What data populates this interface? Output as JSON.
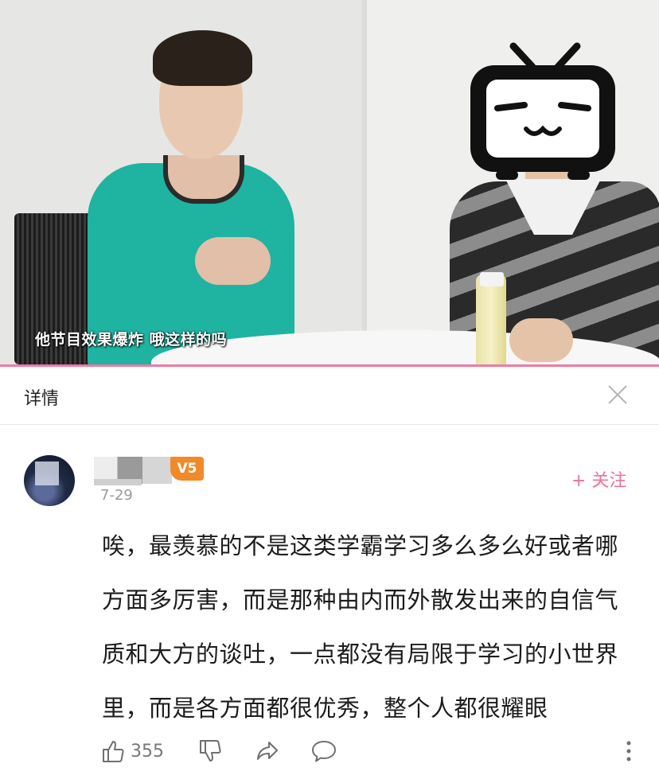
{
  "video": {
    "subtitle": "他节目效果爆炸 哦这样的吗"
  },
  "detail": {
    "title": "详情"
  },
  "comment": {
    "level": "V5",
    "date": "7-29",
    "follow_label": "+ 关注",
    "lines": [
      "唉，最羡慕的不是这类学霸学习多么多么好或者哪",
      "方面多厉害，而是那种由内而外散发出来的自信气",
      "质和大方的谈吐，一点都没有局限于学习的小世界",
      "里，而是各方面都很优秀，整个人都很耀眼"
    ],
    "like_count": "355"
  },
  "colors": {
    "accent_pink": "#f07094",
    "level_orange": "#f08a2b",
    "progress_pink": "#f27aa0"
  },
  "icons": [
    "close-icon",
    "thumbs-up-icon",
    "thumbs-down-icon",
    "share-icon",
    "comment-icon",
    "more-vertical-icon",
    "bilibili-tv-icon"
  ]
}
